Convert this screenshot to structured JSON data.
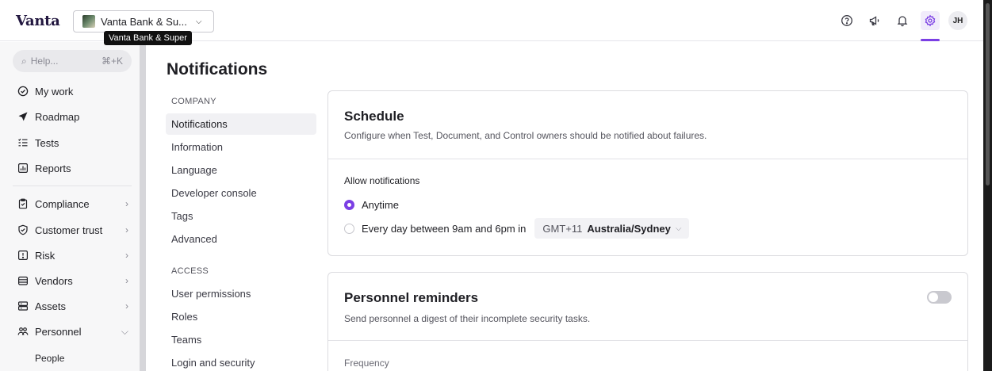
{
  "app": {
    "logo": "Vanta",
    "org_name": "Vanta Bank & Su...",
    "org_tooltip": "Vanta Bank & Super",
    "user_initials": "JH"
  },
  "top_icons": [
    "help-icon",
    "megaphone-icon",
    "bell-icon",
    "gear-icon"
  ],
  "sidebar": {
    "search_placeholder": "Help...",
    "search_shortcut": "⌘+K",
    "items": [
      {
        "label": "My work",
        "icon": "check-circle-icon"
      },
      {
        "label": "Roadmap",
        "icon": "send-icon"
      },
      {
        "label": "Tests",
        "icon": "list-check-icon"
      },
      {
        "label": "Reports",
        "icon": "chart-icon"
      },
      {
        "label": "Compliance",
        "icon": "clipboard-icon"
      },
      {
        "label": "Customer trust",
        "icon": "shield-icon"
      },
      {
        "label": "Risk",
        "icon": "alert-icon"
      },
      {
        "label": "Vendors",
        "icon": "vendor-icon"
      },
      {
        "label": "Assets",
        "icon": "server-icon"
      },
      {
        "label": "Personnel",
        "icon": "people-icon"
      }
    ],
    "sub_people": "People"
  },
  "page": {
    "title": "Notifications",
    "company_label": "COMPANY",
    "company_items": [
      "Notifications",
      "Information",
      "Language",
      "Developer console",
      "Tags",
      "Advanced"
    ],
    "access_label": "ACCESS",
    "access_items": [
      "User permissions",
      "Roles",
      "Teams",
      "Login and security"
    ]
  },
  "schedule": {
    "title": "Schedule",
    "description": "Configure when Test, Document, and Control owners should be notified about failures.",
    "allow_label": "Allow notifications",
    "option_anytime": "Anytime",
    "option_window": "Every day between 9am and 6pm in",
    "tz_offset": "GMT+11",
    "tz_name": "Australia/Sydney",
    "selected": "Anytime"
  },
  "personnel_reminders": {
    "title": "Personnel reminders",
    "description": "Send personnel a digest of their incomplete security tasks.",
    "enabled": false,
    "frequency_label": "Frequency"
  },
  "colors": {
    "accent": "#7b3fe4",
    "border": "#dcdce0",
    "sidebar_bg": "#f7f7f8"
  }
}
